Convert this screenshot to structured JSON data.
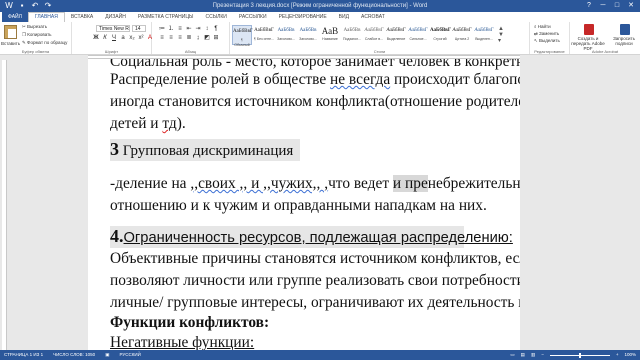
{
  "window": {
    "title": "Презентация 3 лекция.docx [Режим ограниченной функциональности] - Word"
  },
  "tabs": [
    {
      "label": "ФАЙЛ"
    },
    {
      "label": "ГЛАВНАЯ"
    },
    {
      "label": "ВСТАВКА"
    },
    {
      "label": "ДИЗАЙН"
    },
    {
      "label": "РАЗМЕТКА СТРАНИЦЫ"
    },
    {
      "label": "ССЫЛКИ"
    },
    {
      "label": "РАССЫЛКИ"
    },
    {
      "label": "РЕЦЕНЗИРОВАНИЕ"
    },
    {
      "label": "ВИД"
    },
    {
      "label": "ACROBAT"
    }
  ],
  "ribbon": {
    "clipboard": {
      "paste": "Вставить",
      "cut": "Вырезать",
      "copy": "Копировать",
      "format_painter": "Формат по образцу",
      "label": "Буфер обмена"
    },
    "font": {
      "name": "Times New R",
      "size": "14",
      "label": "Шрифт"
    },
    "paragraph": {
      "label": "Абзац"
    },
    "styles": {
      "items": [
        {
          "sample": "АаБбВвГ",
          "name": "¶ Обычный"
        },
        {
          "sample": "АаБбВвГ",
          "name": "¶ Без инте..."
        },
        {
          "sample": "АаБбВв",
          "name": "Заголово..."
        },
        {
          "sample": "АаБбВв",
          "name": "Заголово..."
        },
        {
          "sample": "АаВ",
          "name": "Название"
        },
        {
          "sample": "АаБбВв",
          "name": "Подзагол..."
        },
        {
          "sample": "АаБбВвГ",
          "name": "Слабое в..."
        },
        {
          "sample": "АаБбВвГ",
          "name": "Выделение"
        },
        {
          "sample": "АаБбВвГ",
          "name": "Сильное..."
        },
        {
          "sample": "АаБбВвГ",
          "name": "Строгий"
        },
        {
          "sample": "АаБбВвГ",
          "name": "Цитата 2"
        },
        {
          "sample": "АаБбВвГ",
          "name": "Выделен..."
        }
      ],
      "label": "Стили"
    },
    "editing": {
      "find": "Найти",
      "replace": "Заменить",
      "select": "Выделить",
      "label": "Редактирование"
    },
    "acrobat": {
      "create": "Создать и передать Adobe PDF",
      "request": "Запросить подписи",
      "label": "Adobe Acrobat"
    }
  },
  "document": {
    "line0": "Социальная роль - место, которое занимает человек в конкретный момент.",
    "line1a": "Распределение ролей в обществе ",
    "line1b": "не  всегда",
    "line1c": " происходит благополучно и",
    "line2": "иногда становится источником конфликта(отношение родителей и взрослых",
    "line3a": "детей и ",
    "line3b": "тд",
    "line3c": ").",
    "h3num": "3",
    "h3text": " Групповая дискриминация",
    "line5a": "-деление на ",
    "line5b": ",,своих ,, и ,,чужих,, ,",
    "line5c": "что ведет ",
    "line5d": "и пре",
    "line5e": "небрежительному",
    "line6": "отношению и к чужим и оправданными нападкам на них.",
    "h4num": "4.",
    "h4text": "Ограниченность ресурсов, подлежащая распределению:",
    "para1": "Объективные причины становятся источником конфликтов, если они не",
    "para2": "позволяют личности или группе реализовать свои потребности, затрагивает",
    "para3": "личные/ групповые интересы, ограничивают их деятельность и поведение.",
    "h5": "Функции конфликтов:",
    "h6": "Негативные функции:"
  },
  "status": {
    "page": "СТРАНИЦА 1 ИЗ 1",
    "words": "ЧИСЛО СЛОВ: 1050",
    "lang": "РУССКИЙ",
    "zoom": "100%"
  }
}
